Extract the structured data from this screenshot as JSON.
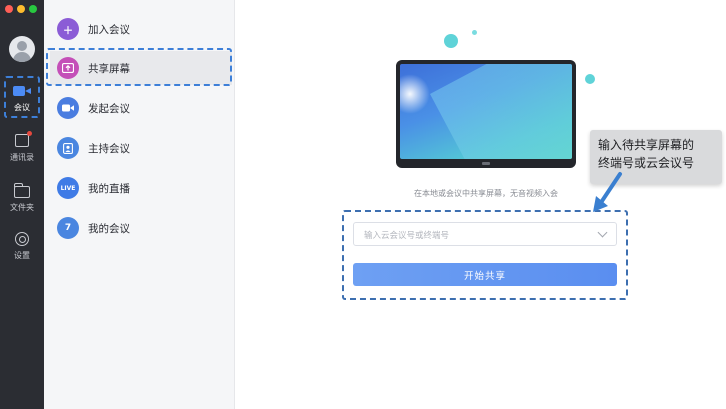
{
  "window": {
    "traffic_lights": [
      {
        "name": "close",
        "color": "#ff5f57"
      },
      {
        "name": "minimize",
        "color": "#febc2e"
      },
      {
        "name": "zoom",
        "color": "#28c840"
      }
    ]
  },
  "sidebar": {
    "items": [
      {
        "label": "会议",
        "icon": "video-camera-icon",
        "active": true
      },
      {
        "label": "通讯录",
        "icon": "contacts-icon"
      },
      {
        "label": "文件夹",
        "icon": "folder-icon"
      },
      {
        "label": "设置",
        "icon": "gear-icon"
      }
    ]
  },
  "menu": {
    "items": [
      {
        "label": "加入会议",
        "icon": "plus-icon",
        "color": "#8b5cd6"
      },
      {
        "label": "共享屏幕",
        "icon": "share-screen-icon",
        "color": "#c44fb8",
        "selected": true
      },
      {
        "label": "发起会议",
        "icon": "video-icon",
        "color": "#4a7de0"
      },
      {
        "label": "主持会议",
        "icon": "host-icon",
        "color": "#4a86e0"
      },
      {
        "label": "我的直播",
        "icon": "live-icon",
        "color": "#3f7be6",
        "badge": "LIVE"
      },
      {
        "label": "我的会议",
        "icon": "calendar-icon",
        "color": "#4a86e0",
        "badge": "7"
      }
    ]
  },
  "main": {
    "hint": "在本地或会议中共享屏幕，无音视频入会",
    "select_placeholder": "输入云会议号或终端号",
    "start_button": "开始共享"
  },
  "callout": {
    "line1": "输入待共享屏幕的",
    "line2": "终端号或云会议号"
  },
  "colors": {
    "accent": "#4c8bf5",
    "annotation": "#3d7fd8",
    "rail_bg": "#2b2d33"
  }
}
